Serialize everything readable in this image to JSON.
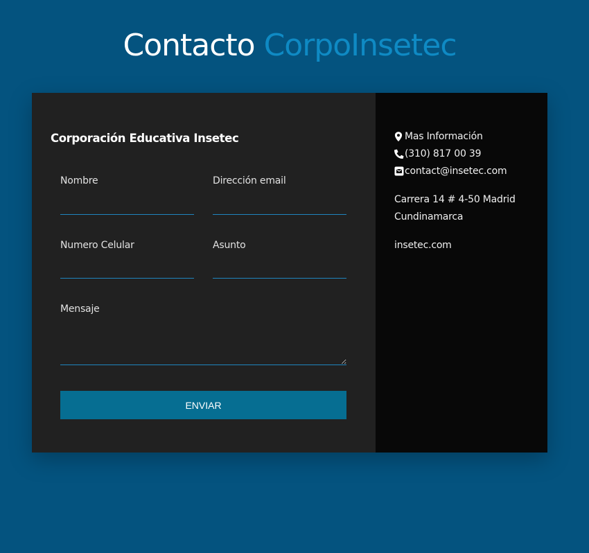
{
  "header": {
    "title_main": "Contacto",
    "title_brand": "CorpoInsetec"
  },
  "form": {
    "org_name": "Corporación Educativa Insetec",
    "fields": {
      "nombre": {
        "label": "Nombre",
        "value": ""
      },
      "email": {
        "label": "Dirección email",
        "value": ""
      },
      "celular": {
        "label": "Numero Celular",
        "value": ""
      },
      "asunto": {
        "label": "Asunto",
        "value": ""
      },
      "mensaje": {
        "label": "Mensaje",
        "value": ""
      }
    },
    "submit_label": "ENVIAR"
  },
  "info": {
    "more_info": "Mas Información",
    "phone": "(310) 817 00 39",
    "email": "contact@insetec.com",
    "address_line1": "Carrera 14 # 4-50 Madrid",
    "address_line2": "Cundinamarca",
    "website": "insetec.com",
    "icons": {
      "more_info": "map-marker-icon",
      "phone": "phone-icon",
      "email": "envelope-square-icon"
    }
  },
  "colors": {
    "page_background": "#04537f",
    "brand_accent": "#0f8ac4",
    "form_panel": "#212121",
    "info_panel": "#080808",
    "button": "#066e92",
    "input_underline": "#1f86c0"
  }
}
